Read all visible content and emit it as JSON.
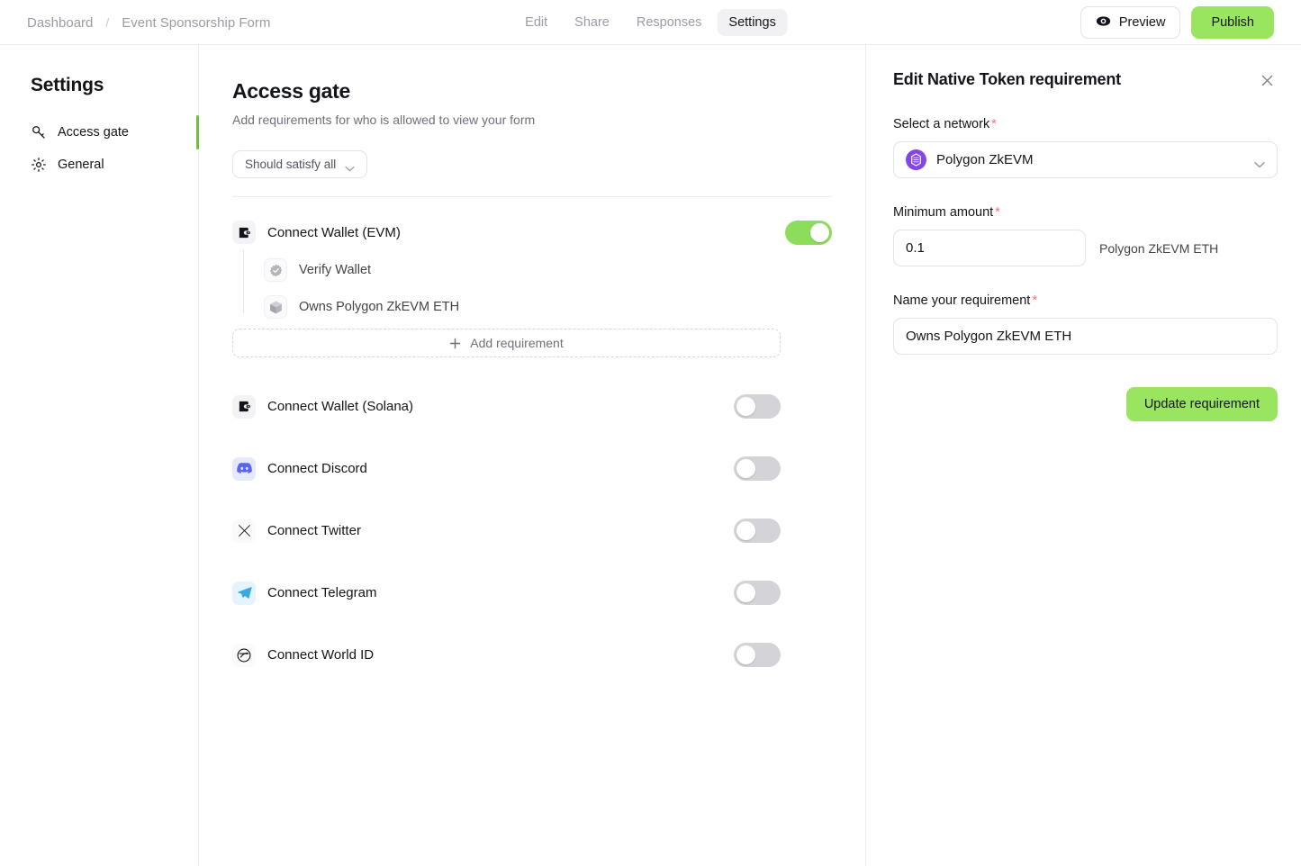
{
  "topbar": {
    "breadcrumb": {
      "root": "Dashboard",
      "separator": "/",
      "current": "Event Sponsorship Form"
    },
    "tabs": [
      {
        "label": "Edit",
        "active": false
      },
      {
        "label": "Share",
        "active": false
      },
      {
        "label": "Responses",
        "active": false
      },
      {
        "label": "Settings",
        "active": true
      }
    ],
    "preview_label": "Preview",
    "publish_label": "Publish",
    "preview_icon": "eye-icon"
  },
  "sidebar": {
    "title": "Settings",
    "items": [
      {
        "label": "Access gate",
        "icon": "key-icon",
        "active": true
      },
      {
        "label": "General",
        "icon": "gear-icon",
        "active": false
      }
    ],
    "active_color": "#76bc43"
  },
  "main": {
    "title": "Access gate",
    "subtitle": "Add requirements for who is allowed to view your form",
    "satisfy_dropdown": {
      "label": "Should satisfy all",
      "icon": "chevron-down-icon"
    },
    "primary_requirement": {
      "label": "Connect Wallet (EVM)",
      "icon": "wallet-icon",
      "enabled": true,
      "sub_requirements": [
        {
          "label": "Verify Wallet",
          "icon": "check-badge-icon"
        },
        {
          "label": "Owns Polygon ZkEVM ETH",
          "icon": "cube-icon"
        }
      ],
      "add_label": "Add requirement",
      "add_icon": "plus-icon"
    },
    "connectors": [
      {
        "label": "Connect Wallet (Solana)",
        "icon": "wallet-icon",
        "enabled": false
      },
      {
        "label": "Connect Discord",
        "icon": "discord-icon",
        "enabled": false
      },
      {
        "label": "Connect Twitter",
        "icon": "twitter-x-icon",
        "enabled": false
      },
      {
        "label": "Connect Telegram",
        "icon": "telegram-icon",
        "enabled": false
      },
      {
        "label": "Connect World ID",
        "icon": "worldid-icon",
        "enabled": false
      }
    ]
  },
  "panel": {
    "title": "Edit Native Token requirement",
    "close_icon": "close-icon",
    "network_label": "Select a network",
    "network_required": "*",
    "network_value": "Polygon ZkEVM",
    "network_icon": "polygon-icon",
    "network_icon_color": "#8247e5",
    "network_chevron": "chevron-down-icon",
    "amount_label": "Minimum amount",
    "amount_required": "*",
    "amount_value": "0.1",
    "amount_unit": "Polygon ZkEVM ETH",
    "name_label": "Name your requirement",
    "name_required": "*",
    "name_value": "Owns Polygon ZkEVM ETH",
    "update_label": "Update requirement",
    "accent_color": "#9ae55f"
  }
}
